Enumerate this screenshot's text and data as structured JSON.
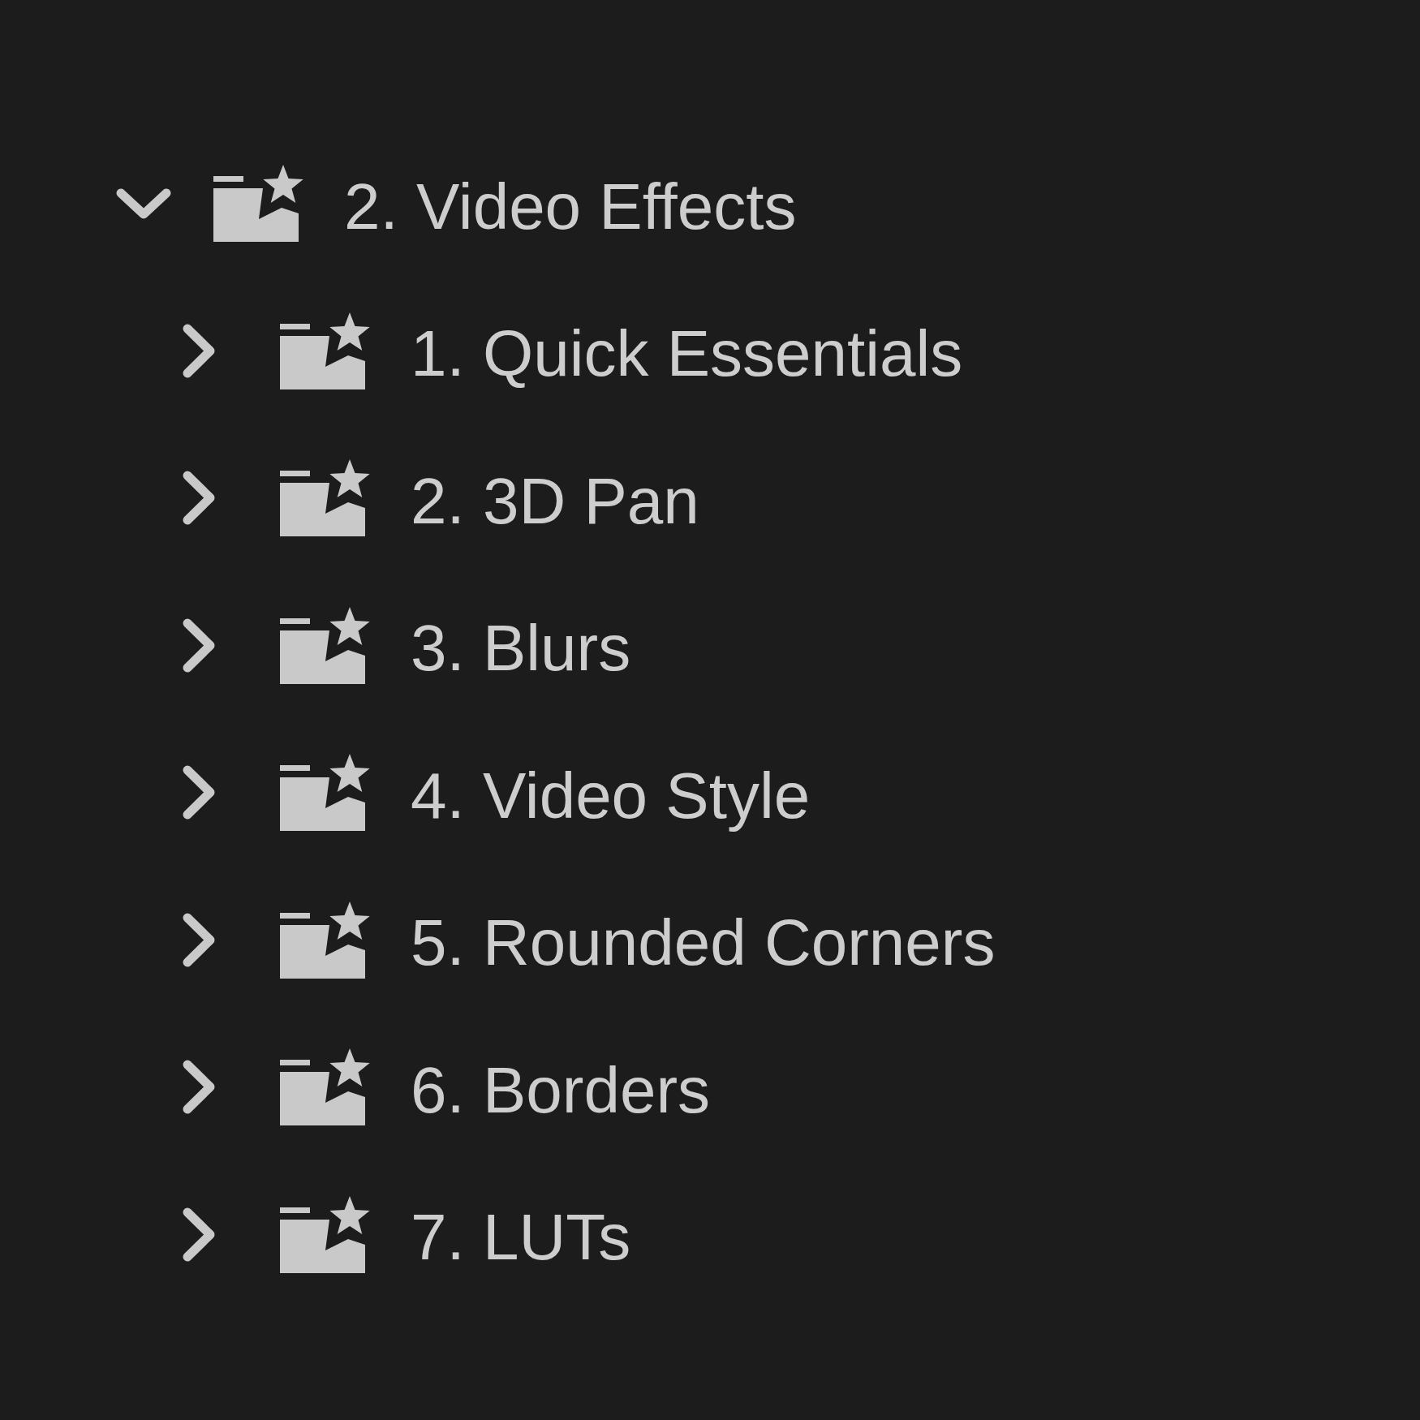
{
  "tree": [
    {
      "label": "2. Video Effects",
      "expanded": true,
      "children": [
        {
          "label": "1. Quick Essentials",
          "expanded": false
        },
        {
          "label": "2. 3D Pan",
          "expanded": false
        },
        {
          "label": "3. Blurs",
          "expanded": false
        },
        {
          "label": "4. Video Style",
          "expanded": false
        },
        {
          "label": "5. Rounded Corners",
          "expanded": false
        },
        {
          "label": "6. Borders",
          "expanded": false
        },
        {
          "label": "7. LUTs",
          "expanded": false
        }
      ]
    }
  ]
}
